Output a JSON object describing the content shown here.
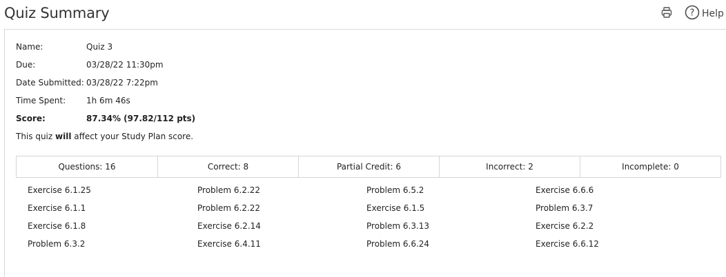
{
  "header": {
    "title": "Quiz Summary",
    "print_icon": "printer-icon",
    "help_icon": "help-circle-icon",
    "help_label": "Help"
  },
  "info": {
    "name_label": "Name:",
    "name_value": "Quiz 3",
    "due_label": "Due:",
    "due_value": "03/28/22 11:30pm",
    "submitted_label": "Date Submitted:",
    "submitted_value": "03/28/22 7:22pm",
    "time_label": "Time Spent:",
    "time_value": "1h 6m 46s",
    "score_label": "Score:",
    "score_value": "87.34% (97.82/112 pts)"
  },
  "note": {
    "prefix": "This quiz ",
    "emphasis": "will",
    "suffix": " affect your Study Plan score."
  },
  "stats": [
    "Questions: 16",
    "Correct: 8",
    "Partial Credit: 6",
    "Incorrect: 2",
    "Incomplete: 0"
  ],
  "exercises": [
    [
      "Exercise 6.1.25",
      "Exercise 6.1.1",
      "Exercise 6.1.8",
      "Problem 6.3.2"
    ],
    [
      "Problem 6.2.22",
      "Problem 6.2.22",
      "Exercise 6.2.14",
      "Exercise 6.4.11"
    ],
    [
      "Problem 6.5.2",
      "Exercise 6.1.5",
      "Problem 6.3.13",
      "Problem 6.6.24"
    ],
    [
      "Exercise 6.6.6",
      "Problem 6.3.7",
      "Exercise 6.2.2",
      "Exercise 6.6.12"
    ]
  ]
}
